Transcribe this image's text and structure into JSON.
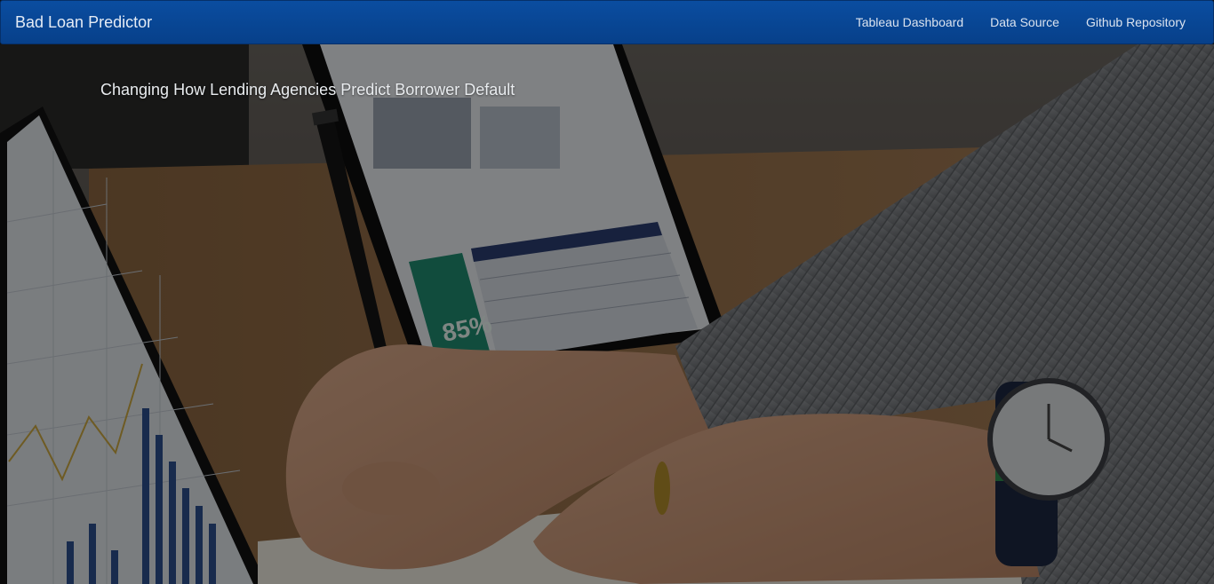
{
  "navbar": {
    "brand": "Bad Loan Predictor",
    "links": [
      "Tableau Dashboard",
      "Data Source",
      "Github Repository"
    ]
  },
  "hero": {
    "tagline": "Changing How Lending Agencies Predict Borrower Default",
    "tablet_percentage": "85%"
  },
  "colors": {
    "navbar_bg": "#07408a",
    "overlay": "rgba(0,0,0,0.45)"
  }
}
